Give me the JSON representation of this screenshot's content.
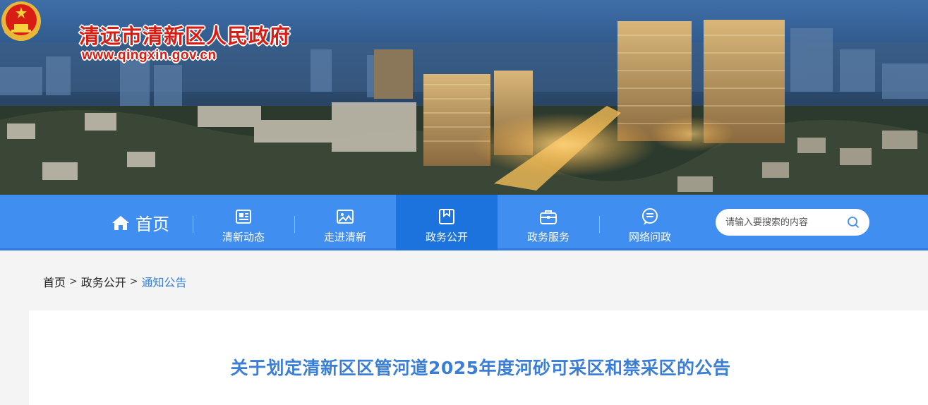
{
  "header": {
    "site_title": "清远市清新区人民政府",
    "site_url": "www.qingxin.gov.cn"
  },
  "nav": {
    "home_label": "首页",
    "items": [
      {
        "label": "清新动态",
        "icon": "news-icon",
        "active": false
      },
      {
        "label": "走进清新",
        "icon": "picture-icon",
        "active": false
      },
      {
        "label": "政务公开",
        "icon": "archive-box-icon",
        "active": true
      },
      {
        "label": "政务服务",
        "icon": "briefcase-icon",
        "active": false
      },
      {
        "label": "网络问政",
        "icon": "chat-bubble-icon",
        "active": false
      }
    ],
    "search_placeholder": "请输入要搜索的内容"
  },
  "breadcrumb": {
    "items": [
      "首页",
      "政务公开",
      "通知公告"
    ],
    "separator": ">"
  },
  "article": {
    "title": "关于划定清新区区管河道2025年度河砂可采区和禁采区的公告"
  },
  "colors": {
    "nav_bg": "#3f8ef0",
    "nav_active": "#1c73de",
    "title_blue": "#3a7fd5",
    "site_red": "#d81e14"
  }
}
